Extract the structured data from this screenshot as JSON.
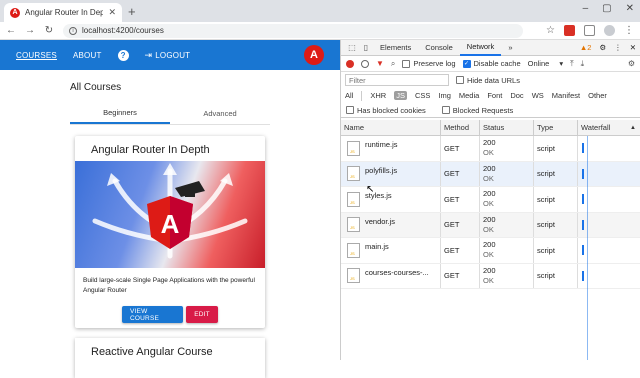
{
  "browser": {
    "tab_title": "Angular Router In Depth",
    "tab_favicon": "A",
    "url": "localhost:4200/courses"
  },
  "app": {
    "nav": {
      "courses": "COURSES",
      "about": "ABOUT",
      "help": "?",
      "logout": "LOGOUT",
      "logo": "A"
    },
    "page_title": "All Courses",
    "tabs": [
      "Beginners",
      "Advanced"
    ],
    "card": {
      "title": "Angular Router In Depth",
      "description": "Build large-scale Single Page Applications with the powerful Angular Router",
      "view_label": "VIEW COURSE",
      "edit_label": "EDIT"
    },
    "card2": {
      "title": "Reactive Angular Course"
    }
  },
  "devtools": {
    "tabs": [
      "Elements",
      "Console",
      "Network"
    ],
    "more": "»",
    "warnings": "▲2",
    "toolbar": {
      "preserve_log": "Preserve log",
      "disable_cache": "Disable cache",
      "throttle": "Online"
    },
    "filter_placeholder": "Filter",
    "hide_data_urls": "Hide data URLs",
    "types": [
      "All",
      "XHR",
      "JS",
      "CSS",
      "Img",
      "Media",
      "Font",
      "Doc",
      "WS",
      "Manifest",
      "Other"
    ],
    "has_blocked_cookies": "Has blocked cookies",
    "blocked_requests": "Blocked Requests",
    "columns": {
      "name": "Name",
      "method": "Method",
      "status": "Status",
      "type": "Type",
      "waterfall": "Waterfall"
    },
    "rows": [
      {
        "name": "runtime.js",
        "method": "GET",
        "code": "200",
        "text": "OK",
        "type": "script"
      },
      {
        "name": "polyfills.js",
        "method": "GET",
        "code": "200",
        "text": "OK",
        "type": "script"
      },
      {
        "name": "styles.js",
        "method": "GET",
        "code": "200",
        "text": "OK",
        "type": "script"
      },
      {
        "name": "vendor.js",
        "method": "GET",
        "code": "200",
        "text": "OK",
        "type": "script"
      },
      {
        "name": "main.js",
        "method": "GET",
        "code": "200",
        "text": "OK",
        "type": "script"
      },
      {
        "name": "courses-courses-...",
        "method": "GET",
        "code": "200",
        "text": "OK",
        "type": "script"
      }
    ]
  },
  "colors": {
    "primary": "#1976d2",
    "warn": "#d81b47",
    "angular_red": "#dd1b16",
    "devtools_blue": "#1a73e8"
  }
}
